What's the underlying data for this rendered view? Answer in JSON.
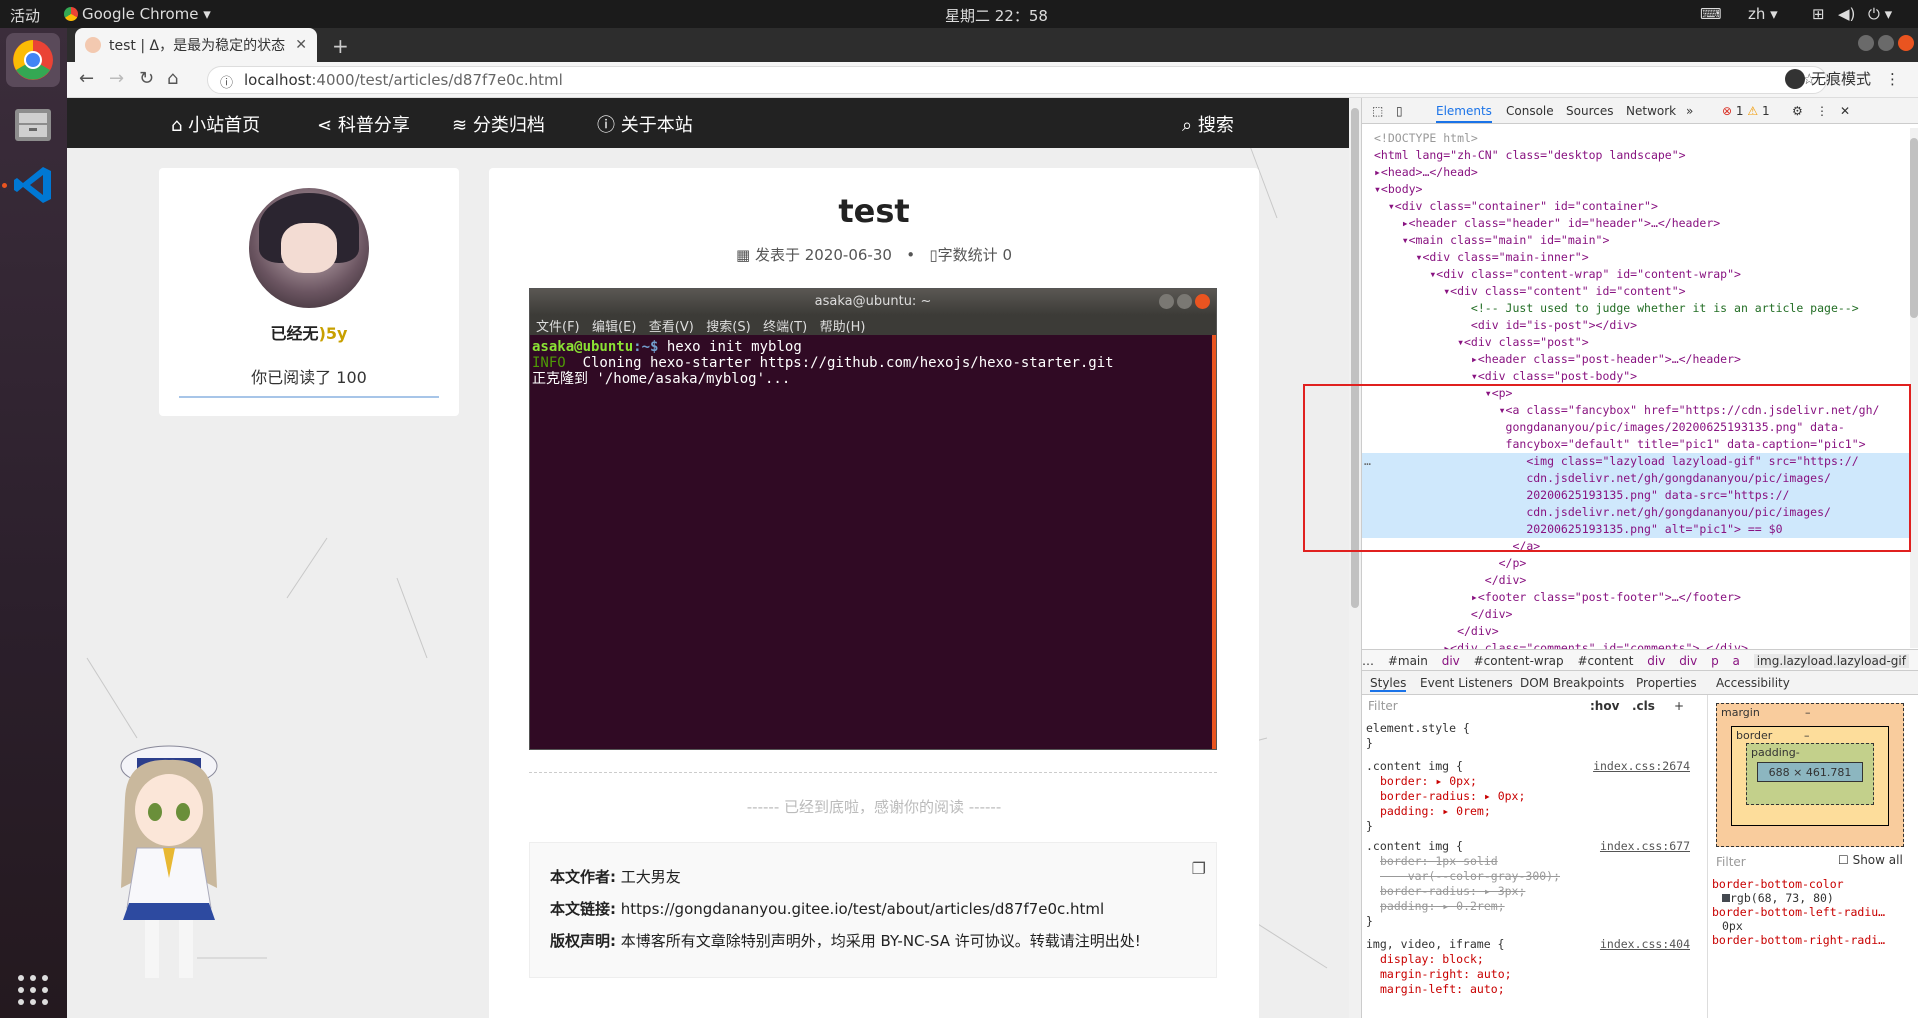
{
  "os": {
    "activities": "活动",
    "app_name": "Google Chrome",
    "clock": "星期二 22：58",
    "lang": "zh"
  },
  "browser": {
    "tab_title": "test | Δ，是最为稳定的状态",
    "url_host": "localhost",
    "url_path": ":4000/test/articles/d87f7e0c.html",
    "incognito": "无痕模式"
  },
  "site_nav": {
    "home": "小站首页",
    "share": "科普分享",
    "archive": "分类归档",
    "about": "关于本站",
    "search": "搜索"
  },
  "sidebar": {
    "name_prefix": "已经无",
    "name_suffix": ")5y",
    "read_text": "你已阅读了 100"
  },
  "post": {
    "title": "test",
    "posted_label": "发表于",
    "date": "2020-06-30",
    "separator": "•",
    "wordcount_label": "字数统计",
    "wordcount": "0",
    "end_text": "------ 已经到底啦，感谢你的阅读 ------",
    "author_label": "本文作者:",
    "author": "工大男友",
    "link_label": "本文链接:",
    "link": "https://gongdananyou.gitee.io/test/about/articles/d87f7e0c.html",
    "license_label": "版权声明:",
    "license": "本博客所有文章除特别声明外，均采用 BY-NC-SA 许可协议。转载请注明出处!"
  },
  "terminal": {
    "title": "asaka@ubuntu: ~",
    "menu": [
      "文件(F)",
      "编辑(E)",
      "查看(V)",
      "搜索(S)",
      "终端(T)",
      "帮助(H)"
    ],
    "prompt_user": "asaka@ubuntu",
    "prompt_path": ":~$",
    "command": " hexo init myblog",
    "info_tag": "INFO",
    "info_line": "  Cloning hexo-starter https://github.com/hexojs/hexo-starter.git",
    "clone_line": "正克隆到 '/home/asaka/myblog'..."
  },
  "devtools": {
    "tabs": [
      "Elements",
      "Console",
      "Sources",
      "Network"
    ],
    "errors": "1",
    "warnings": "1",
    "dom_lines": [
      "<!DOCTYPE html>",
      "<html lang=\"zh-CN\" class=\"desktop landscape\">",
      "▸<head>…</head>",
      "▾<body>",
      "  ▾<div class=\"container\" id=\"container\">",
      "    ▸<header class=\"header\" id=\"header\">…</header>",
      "    ▾<main class=\"main\" id=\"main\">",
      "      ▾<div class=\"main-inner\">",
      "        ▾<div class=\"content-wrap\" id=\"content-wrap\">",
      "          ▾<div class=\"content\" id=\"content\">",
      "              <!-- Just used to judge whether it is an article page-->",
      "              <div id=\"is-post\"></div>",
      "            ▾<div class=\"post\">",
      "              ▸<header class=\"post-header\">…</header>",
      "              ▾<div class=\"post-body\">",
      "                ▾<p>",
      "                  ▾<a class=\"fancybox\" href=\"https://cdn.jsdelivr.net/gh/",
      "                   gongdananyou/pic/images/20200625193135.png\" data-",
      "                   fancybox=\"default\" title=\"pic1\" data-caption=\"pic1\">",
      "                      <img class=\"lazyload lazyload-gif\" src=\"https://",
      "                      cdn.jsdelivr.net/gh/gongdananyou/pic/images/",
      "                      20200625193135.png\" data-src=\"https://",
      "                      cdn.jsdelivr.net/gh/gongdananyou/pic/images/",
      "                      20200625193135.png\" alt=\"pic1\"> == $0",
      "                    </a>",
      "                  </p>",
      "                </div>",
      "              ▸<footer class=\"post-footer\">…</footer>",
      "              </div>",
      "            </div>",
      "          ▸<div class=\"comments\" id=\"comments\">…</div>",
      "          </div>"
    ],
    "breadcrumbs": [
      "…",
      "#main",
      "div",
      "#content-wrap",
      "#content",
      "div",
      "div",
      "p",
      "a",
      "img.lazyload.lazyload-gif"
    ],
    "style_tabs": [
      "Styles",
      "Event Listeners",
      "DOM Breakpoints",
      "Properties",
      "Accessibility"
    ],
    "filter_placeholder": "Filter",
    "hov": ":hov",
    "cls": ".cls",
    "styles": {
      "element_style": "element.style {",
      "rule1_selector": ".content img {",
      "rule1_src": "index.css:2674",
      "rule1_props": [
        "border: ▸ 0px;",
        "border-radius: ▸ 0px;",
        "padding: ▸ 0rem;"
      ],
      "rule2_selector": ".content img {",
      "rule2_src": "index.css:677",
      "rule2_props": [
        "border: 1px solid",
        "    var(--color-gray-300);",
        "border-radius: ▸ 3px;",
        "padding: ▸ 0.2rem;"
      ],
      "rule3_selector": "img, video, iframe {",
      "rule3_src": "index.css:404",
      "rule3_props": [
        "display: block;",
        "margin-right: auto;",
        "margin-left: auto;"
      ]
    },
    "boxmodel": {
      "margin": "margin",
      "border": "border",
      "padding": "padding-",
      "content": "688 × 461.781",
      "dash": "–"
    },
    "computed_filter": "Filter",
    "show_all": "Show all",
    "computed": [
      "border-bottom-color",
      "rgb(68, 73, 80)",
      "border-bottom-left-radiu…",
      "0px",
      "border-bottom-right-radi…"
    ]
  }
}
